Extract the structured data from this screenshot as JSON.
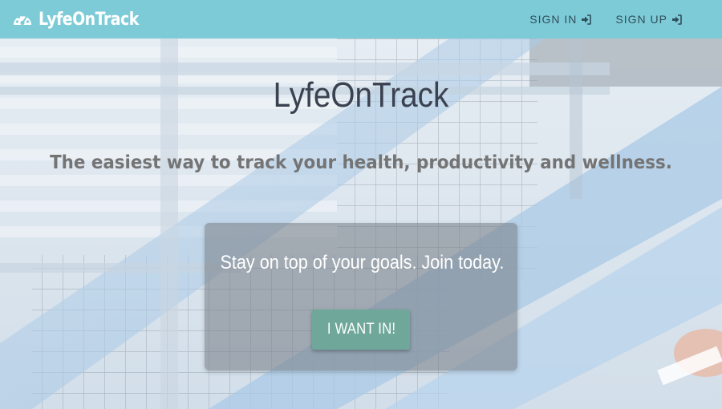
{
  "header": {
    "brand": "LyfeOnTrack",
    "brand_icon": "dashboard-gauge-icon",
    "nav": [
      {
        "label": "SIGN IN",
        "icon": "sign-in-icon"
      },
      {
        "label": "SIGN UP",
        "icon": "sign-in-icon"
      }
    ]
  },
  "hero": {
    "title": "LyfeOnTrack",
    "tagline": "The easiest way to track your health, productivity and wellness.",
    "cta": {
      "text": "Stay on top of your goals. Join today.",
      "button_label": "I WANT IN!"
    }
  },
  "colors": {
    "navbar": "#7ecbd8",
    "button": "#6fa89a",
    "title": "#3a4150",
    "tagline": "#747474"
  }
}
